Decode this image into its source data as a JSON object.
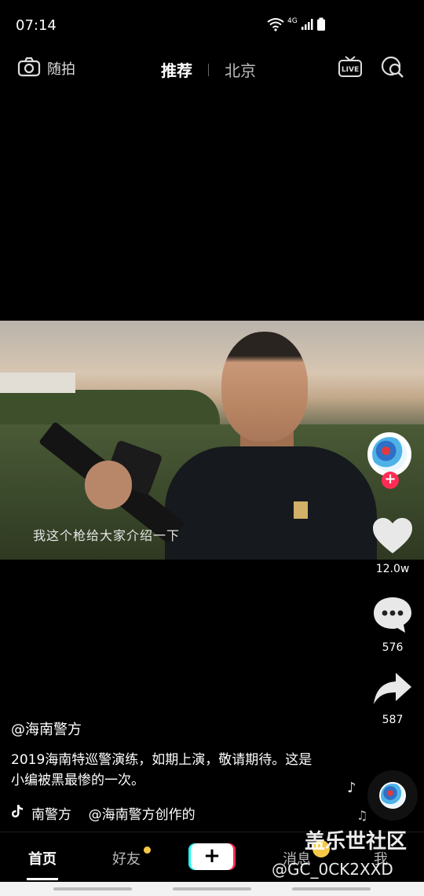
{
  "status_bar": {
    "time": "07:14",
    "network": "4G"
  },
  "top_nav": {
    "camera_label": "随拍",
    "tabs": [
      {
        "label": "推荐",
        "active": true
      },
      {
        "label": "北京",
        "active": false
      }
    ],
    "live_label": "LIVE"
  },
  "video": {
    "subtitle": "我这个枪给大家介绍一下"
  },
  "right_rail": {
    "follow_plus": "+",
    "likes": "12.0w",
    "comments": "576",
    "shares": "587"
  },
  "caption": {
    "author": "@海南警方",
    "description": "2019海南特巡警演练，如期上演，敬请期待。这是小编被黑最惨的一次。"
  },
  "music": {
    "text": "南警方    @海南警方创作的"
  },
  "bottom_nav": {
    "home": "首页",
    "friends": "好友",
    "create": "+",
    "messages": "消息",
    "me": "我"
  },
  "watermark": {
    "line1": "盖乐世社区",
    "line2": "@GC_0CK2XXD"
  },
  "colors": {
    "accent_red": "#fe2c55",
    "accent_cyan": "#25f4ee",
    "badge_yellow": "#f7c948"
  }
}
